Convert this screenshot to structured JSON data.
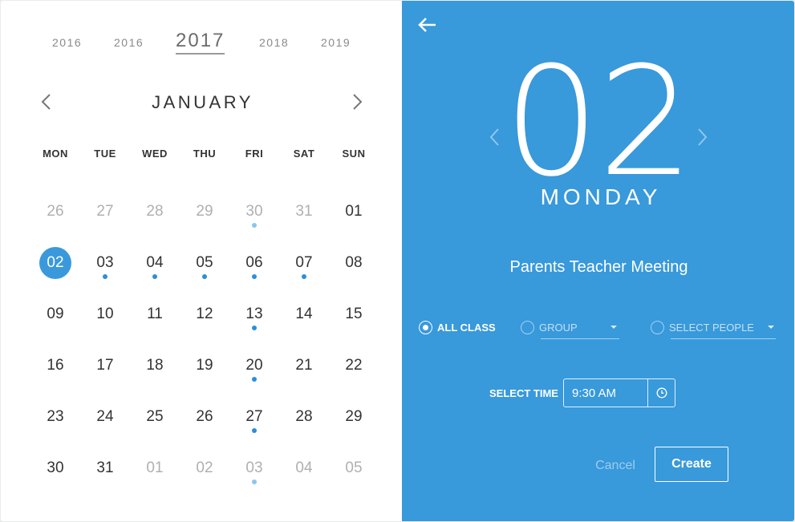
{
  "calendar": {
    "years": [
      "2016",
      "2016",
      "2017",
      "2018",
      "2019"
    ],
    "selected_year": "2017",
    "month": "JANUARY",
    "weekdays": [
      "MON",
      "TUE",
      "WED",
      "THU",
      "FRI",
      "SAT",
      "SUN"
    ],
    "weeks": [
      [
        {
          "d": "26",
          "muted": true
        },
        {
          "d": "27",
          "muted": true
        },
        {
          "d": "28",
          "muted": true
        },
        {
          "d": "29",
          "muted": true
        },
        {
          "d": "30",
          "muted": true,
          "dot": true
        },
        {
          "d": "31",
          "muted": true
        },
        {
          "d": "01"
        }
      ],
      [
        {
          "d": "02",
          "selected": true
        },
        {
          "d": "03",
          "dot": true
        },
        {
          "d": "04",
          "dot": true
        },
        {
          "d": "05",
          "dot": true
        },
        {
          "d": "06",
          "dot": true
        },
        {
          "d": "07",
          "dot": true
        },
        {
          "d": "08"
        }
      ],
      [
        {
          "d": "09"
        },
        {
          "d": "10"
        },
        {
          "d": "11"
        },
        {
          "d": "12"
        },
        {
          "d": "13",
          "dot": true
        },
        {
          "d": "14"
        },
        {
          "d": "15"
        }
      ],
      [
        {
          "d": "16"
        },
        {
          "d": "17"
        },
        {
          "d": "18"
        },
        {
          "d": "19"
        },
        {
          "d": "20",
          "dot": true
        },
        {
          "d": "21"
        },
        {
          "d": "22"
        }
      ],
      [
        {
          "d": "23"
        },
        {
          "d": "24"
        },
        {
          "d": "25"
        },
        {
          "d": "26"
        },
        {
          "d": "27",
          "dot": true
        },
        {
          "d": "28"
        },
        {
          "d": "29"
        }
      ],
      [
        {
          "d": "30"
        },
        {
          "d": "31"
        },
        {
          "d": "01",
          "muted": true
        },
        {
          "d": "02",
          "muted": true
        },
        {
          "d": "03",
          "muted": true,
          "dot": true
        },
        {
          "d": "04",
          "muted": true
        },
        {
          "d": "05",
          "muted": true
        }
      ]
    ]
  },
  "detail": {
    "day_number": "02",
    "weekday": "MONDAY",
    "event_title": "Parents Teacher Meeting",
    "options": {
      "all_class": "ALL CLASS",
      "group": "GROUP",
      "select_people": "SELECT PEOPLE",
      "selected": "all_class"
    },
    "time_label": "SELECT TIME",
    "time_value": "9:30 AM",
    "cancel_label": "Cancel",
    "create_label": "Create"
  },
  "icons": {
    "back": "arrow-left-icon",
    "prev": "chevron-left-icon",
    "next": "chevron-right-icon",
    "clock": "clock-icon",
    "caret": "caret-down-icon"
  },
  "colors": {
    "accent": "#3899db",
    "selected_day": "#3a99dc",
    "event_dot": "#2a8fd8",
    "muted_text": "#b0b0b0"
  }
}
